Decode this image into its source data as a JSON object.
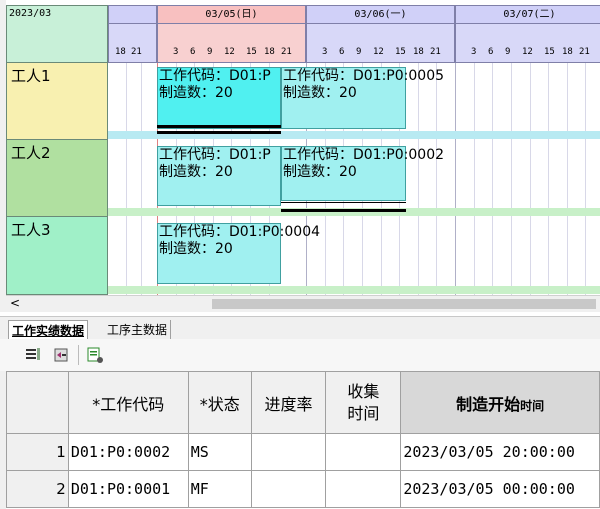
{
  "gantt": {
    "month_label": "2023/03",
    "dates": [
      {
        "label": "03/05(日)",
        "color": "#f8c0c0"
      },
      {
        "label": "03/06(一)",
        "color": "#d0d0f8"
      },
      {
        "label": "03/07(二)",
        "color": "#d0d0f8"
      }
    ],
    "prev_ticks": [
      "18",
      "21"
    ],
    "hour_ticks": [
      "3",
      "6",
      "9",
      "12",
      "15",
      "18",
      "21"
    ],
    "workers": [
      "工人1",
      "工人2",
      "工人3"
    ],
    "worker_colors": [
      "#f8f0b0",
      "#b0e0a0",
      "#a0f0c8"
    ],
    "tasks": [
      {
        "code": "工作代码：D01:P",
        "qty": "制造数：20"
      },
      {
        "code": "工作代码：D01:P0:0005",
        "qty": "制造数：20"
      },
      {
        "code": "工作代码：D01:P",
        "qty": "制造数：20"
      },
      {
        "code": "工作代码：D01:P0:0002",
        "qty": "制造数：20"
      },
      {
        "code": "工作代码：D01:P0:0004",
        "qty": "制造数：20"
      }
    ],
    "scroll_left": "<"
  },
  "tabs": [
    "工作实绩数据",
    "工序主数据"
  ],
  "toolbar_icons": [
    "list-edit-icon",
    "list-undo-icon",
    "list-settings-icon"
  ],
  "table": {
    "headers": [
      "*工作代码",
      "*状态",
      "进度率",
      "收集时间",
      "制造开始"
    ],
    "header_suffix": "时间",
    "rows": [
      {
        "num": "1",
        "code": "D01:P0:0002",
        "status": "MS",
        "progress": "",
        "collect": "",
        "start": "2023/03/05 20:00:00"
      },
      {
        "num": "2",
        "code": "D01:P0:0001",
        "status": "MF",
        "progress": "",
        "collect": "",
        "start": "2023/03/05 00:00:00"
      }
    ]
  }
}
